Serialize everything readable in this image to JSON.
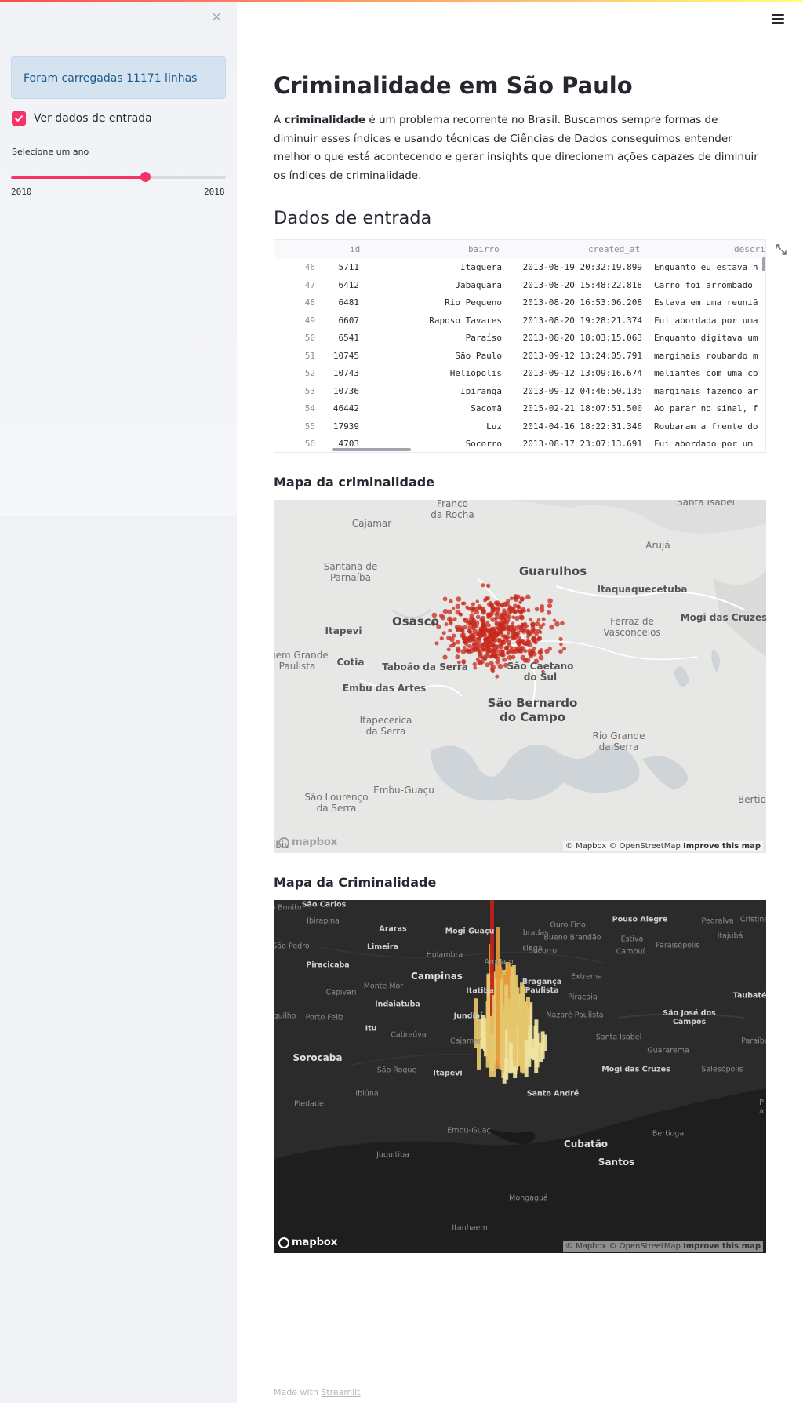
{
  "theme": {
    "primary": "#f63366",
    "info_bg": "#d5e3f1",
    "info_text": "#1c5a8a"
  },
  "sidebar": {
    "close_icon": "×",
    "info_message": "Foram carregadas 11171 linhas",
    "checkbox_label": "Ver dados de entrada",
    "checkbox_checked": true,
    "slider_label": "Selecione um ano",
    "slider_min": "2010",
    "slider_max": "2018",
    "slider_value_fraction": 0.625
  },
  "main": {
    "title": "Criminalidade em São Paulo",
    "intro_prefix": "A ",
    "intro_bold": "criminalidade",
    "intro_rest": " é um problema recorrente no Brasil. Buscamos sempre formas de diminuir esses índices e usando técnicas de Ciências de Dados conseguimos entender melhor o que está acontecendo e gerar insights que direcionem ações capazes de diminuir os índices de criminalidade.",
    "section_input": "Dados de entrada",
    "section_map1": "Mapa da criminalidade",
    "section_map2": "Mapa da Criminalidade",
    "footer_prefix": "Made with ",
    "footer_link": "Streamlit"
  },
  "table": {
    "columns": [
      "id",
      "bairro",
      "created_at",
      "descri"
    ],
    "rows": [
      {
        "idx": "46",
        "id": "5711",
        "bairro": "Itaquera",
        "created_at": "2013-08-19 20:32:19.899",
        "desc": "Enquanto eu estava n"
      },
      {
        "idx": "47",
        "id": "6412",
        "bairro": "Jabaquara",
        "created_at": "2013-08-20 15:48:22.818",
        "desc": "Carro foi arrombado "
      },
      {
        "idx": "48",
        "id": "6481",
        "bairro": "Rio Pequeno",
        "created_at": "2013-08-20 16:53:06.208",
        "desc": "Estava em uma reuniã"
      },
      {
        "idx": "49",
        "id": "6607",
        "bairro": "Raposo Tavares",
        "created_at": "2013-08-20 19:28:21.374",
        "desc": "Fui abordada por uma"
      },
      {
        "idx": "50",
        "id": "6541",
        "bairro": "Paraíso",
        "created_at": "2013-08-20 18:03:15.063",
        "desc": "Enquanto digitava um"
      },
      {
        "idx": "51",
        "id": "10745",
        "bairro": "São Paulo",
        "created_at": "2013-09-12 13:24:05.791",
        "desc": "marginais roubando m"
      },
      {
        "idx": "52",
        "id": "10743",
        "bairro": "Heliópolis",
        "created_at": "2013-09-12 13:09:16.674",
        "desc": "meliantes com uma cb"
      },
      {
        "idx": "53",
        "id": "10736",
        "bairro": "Ipiranga",
        "created_at": "2013-09-12 04:46:50.135",
        "desc": "marginais fazendo ar"
      },
      {
        "idx": "54",
        "id": "46442",
        "bairro": "Sacomã",
        "created_at": "2015-02-21 18:07:51.500",
        "desc": "Ao parar no sinal, f"
      },
      {
        "idx": "55",
        "id": "17939",
        "bairro": "Luz",
        "created_at": "2014-04-16 18:22:31.346",
        "desc": "Roubaram a frente do"
      },
      {
        "idx": "56",
        "id": "4703",
        "bairro": "Socorro",
        "created_at": "2013-08-17 23:07:13.691",
        "desc": "Fui abordado por um "
      }
    ]
  },
  "map1": {
    "labels": {
      "franco": "Franco\nda Rocha",
      "santa_isabel": "Santa Isabel",
      "cajamar": "Cajamar",
      "aruja": "Arujá",
      "santana": "Santana de\nParnaíba",
      "guarulhos": "Guarulhos",
      "itaqua": "Itaquaquecetuba",
      "osasco": "Osasco",
      "itapevi": "Itapevi",
      "ferraz": "Ferraz de\nVasconcelos",
      "mogi": "Mogi das Cruzes",
      "vargem": "rgem Grande\nPaulista",
      "cotia": "Cotia",
      "taboao": "Taboão da Serra",
      "sao_caetano": "São Caetano\ndo Sul",
      "embu": "Embu das Artes",
      "sbc": "São Bernardo\ndo Campo",
      "itapecerica": "Itapecerica\nda Serra",
      "rio_grande": "Rio Grande\nda Serra",
      "embu_guacu": "Embu-Guaçu",
      "sao_lourenco": "São Lourenço\nda Serra",
      "bertioga": "Bertio",
      "ibiuna": "ibiu"
    },
    "attribution_mapbox": "© Mapbox",
    "attribution_osm": "© OpenStreetMap",
    "attribution_improve": "Improve this map",
    "logo_text": "mapbox",
    "point_color": "#c8281c"
  },
  "map2": {
    "labels": {
      "sao_carlos": "São Carlos",
      "bonito": "o Bonito",
      "ibirapina": "Ibirapina",
      "araras": "Araras",
      "mogi_guacu": "Mogi Guaçu",
      "bradas": "bradas",
      "ouro_fino": "Ouro Fino",
      "pouso_alegre": "Pouso Alegre",
      "pedralva": "Pedralva",
      "cristina": "Cristina",
      "sao_pedro": "São Pedro",
      "limeira": "Limeira",
      "holambra": "Holambra",
      "singa": "singa",
      "bueno": "Bueno Brandão",
      "estiva": "Estiva",
      "itajuba": "Itajubá",
      "cambui": "Cambuí",
      "piracicaba": "Piracicaba",
      "amparo": "Amparo",
      "socorro": "Socorro",
      "paraisopolis": "Paraisópolis",
      "campinas": "Campinas",
      "monte_mor": "Monte Mor",
      "capivari": "Capivari",
      "extrema": "Extrema",
      "itatiba": "Itatiba",
      "braganca": "Bragança\nPaulista",
      "indaiatuba": "Indaiatuba",
      "piracaia": "Piracaia",
      "taubate": "Taubaté",
      "jundiai": "Jundiaí",
      "nazare": "Nazaré Paulista",
      "sao_jose": "São José dos\nCampos",
      "porto_feliz": "Porto Feliz",
      "itu": "Itu",
      "quilho": "quilho",
      "cabreuva": "Cabreúva",
      "cajamar": "Cajamar",
      "santa_isabel": "Santa Isabel",
      "paraibu": "Paraibu",
      "guararema": "Guararema",
      "sorocaba": "Sorocaba",
      "sao_roque": "São Roque",
      "itapevi": "Itapevi",
      "mogi": "Mogi das Cruzes",
      "salesopolis": "Salesópolis",
      "ibiuna": "Ibiúna",
      "santo_andre": "Santo André",
      "piedade": "Piedade",
      "embu_guac": "Embu-Guaç",
      "bertioga": "Bertioga",
      "cubatao": "Cubatão",
      "juquitiba": "Juquitiba",
      "santos": "Santos",
      "mongagua": "Mongaguá",
      "itanhaem": "Itanhaem",
      "p_a": "P\na"
    },
    "attribution_mapbox": "© Mapbox",
    "attribution_osm": "© OpenStreetMap",
    "attribution_improve": "Improve this map",
    "logo_text": "mapbox",
    "bar_colors": [
      "#f0e3a0",
      "#e6c56b",
      "#e59a3b",
      "#c2201b"
    ]
  }
}
